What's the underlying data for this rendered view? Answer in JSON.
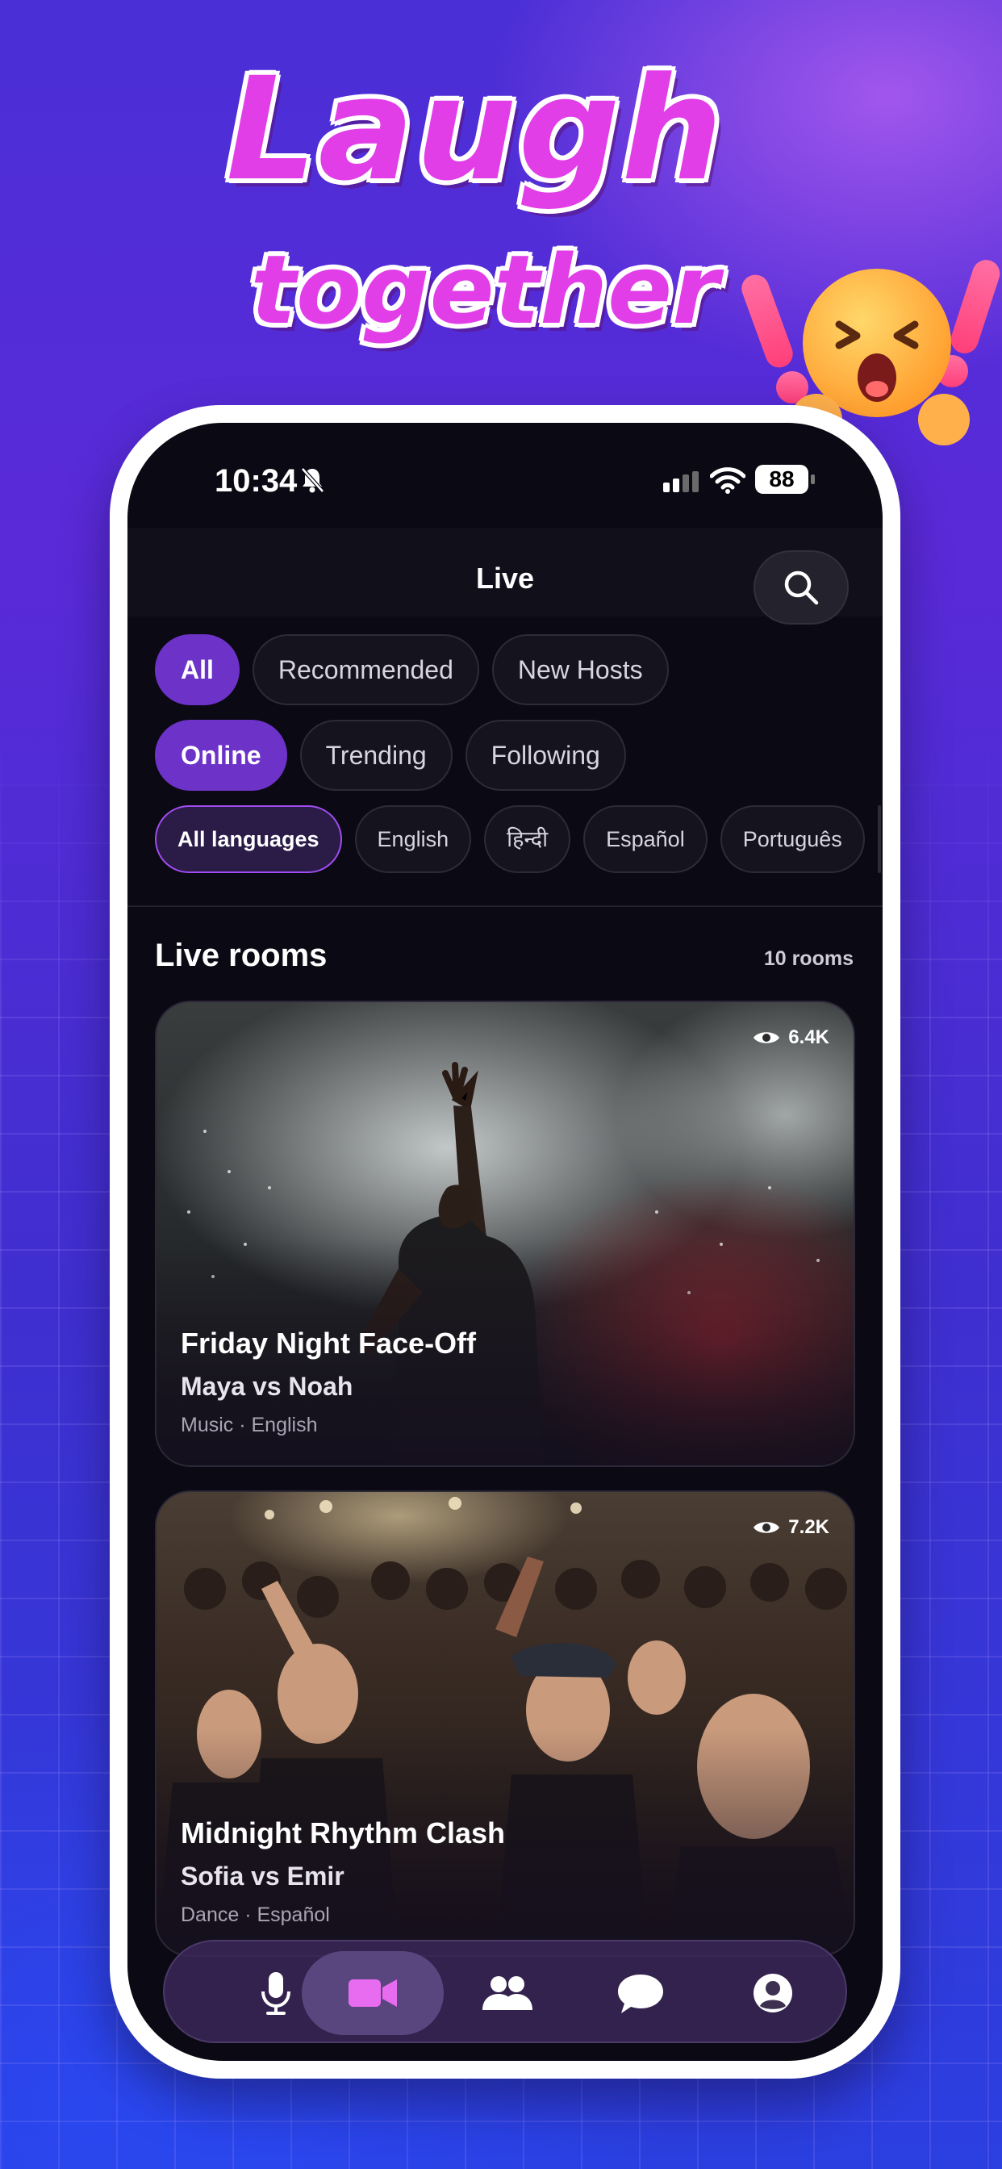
{
  "promo": {
    "headline_line1": "Laugh",
    "headline_line2": "together",
    "headline_color": "#e23ee8"
  },
  "status_bar": {
    "time": "10:34",
    "battery": "88",
    "icons": [
      "bell-slash-icon",
      "signal-icon",
      "wifi-icon",
      "battery-icon"
    ]
  },
  "header": {
    "title": "Live",
    "search_icon": "search-icon"
  },
  "filters": {
    "categories": [
      "All",
      "Recommended",
      "New Hosts"
    ],
    "status": [
      "Online",
      "Trending",
      "Following"
    ],
    "languages": [
      "All languages",
      "English",
      "हिन्दी",
      "Español",
      "Português"
    ],
    "active_category": "All",
    "active_status": "Online",
    "active_language": "All languages"
  },
  "section": {
    "title": "Live rooms",
    "count": "10 rooms"
  },
  "rooms": [
    {
      "viewers": "6.4K",
      "title": "Friday Night Face-Off",
      "hosts": "Maya vs Noah",
      "meta": "Music · English"
    },
    {
      "viewers": "7.2K",
      "title": "Midnight Rhythm Clash",
      "hosts": "Sofia vs Emir",
      "meta": "Dance · Español"
    }
  ],
  "bottom_nav": {
    "items": [
      "mic-icon",
      "video-camera-icon",
      "people-icon",
      "chat-bubble-icon",
      "profile-icon"
    ],
    "active": "video-camera-icon"
  },
  "colors": {
    "accent": "#6d32c8",
    "language_active_border": "#a14cf0",
    "video_icon": "#e86cf0",
    "screen_bg": "#0b0913"
  }
}
